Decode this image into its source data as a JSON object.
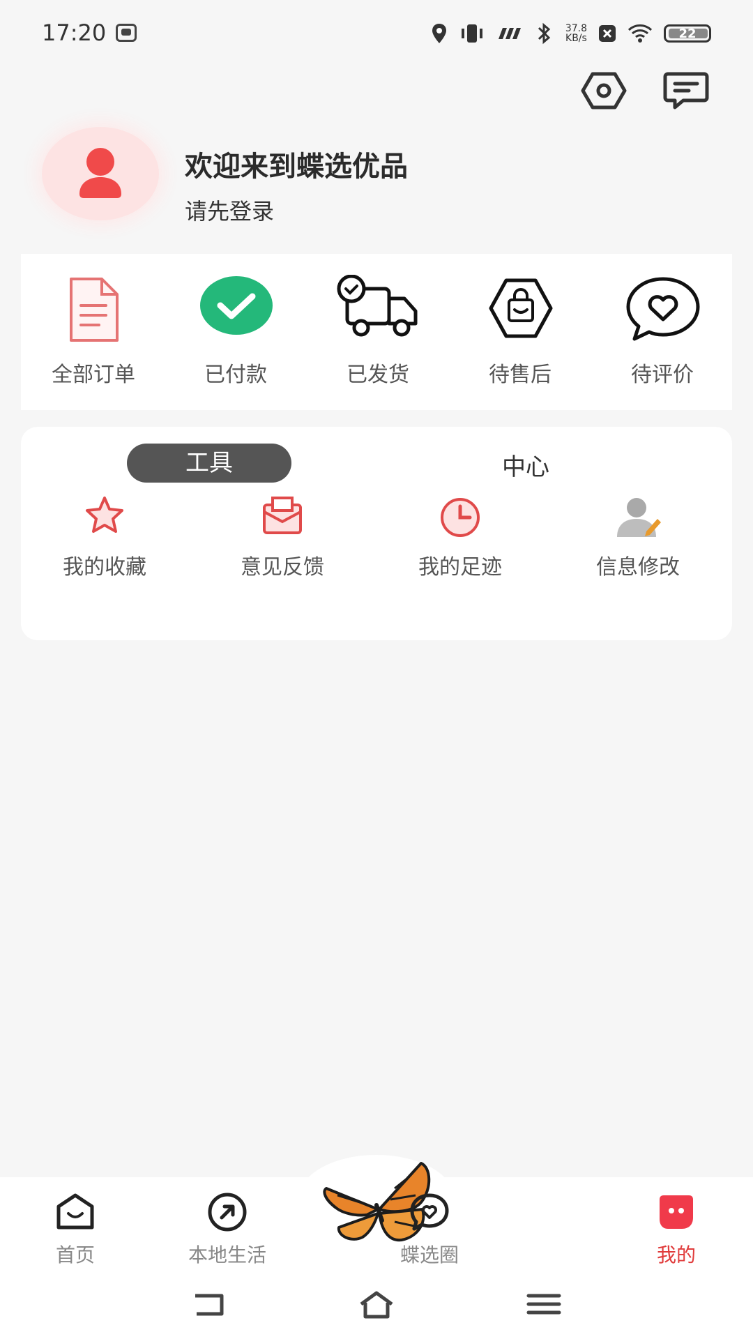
{
  "status_bar": {
    "time": "17:20",
    "speed_value": "37.8",
    "speed_unit": "KB/s",
    "battery": "22"
  },
  "header": {
    "settings_icon": "hexagon-settings-icon",
    "message_icon": "message-icon"
  },
  "profile": {
    "welcome": "欢迎来到蝶选优品",
    "login_prompt": "请先登录"
  },
  "orders": {
    "items": [
      {
        "label": "全部订单",
        "icon": "document-icon"
      },
      {
        "label": "已付款",
        "icon": "check-circle-icon"
      },
      {
        "label": "已发货",
        "icon": "truck-icon"
      },
      {
        "label": "待售后",
        "icon": "shopping-bag-icon"
      },
      {
        "label": "待评价",
        "icon": "heart-bubble-icon"
      }
    ]
  },
  "tools": {
    "tab_tools": "工具",
    "tab_center": "中心",
    "items": [
      {
        "label": "我的收藏",
        "icon": "star-icon"
      },
      {
        "label": "意见反馈",
        "icon": "mail-icon"
      },
      {
        "label": "我的足迹",
        "icon": "clock-icon"
      },
      {
        "label": "信息修改",
        "icon": "user-edit-icon"
      }
    ]
  },
  "bottom_nav": {
    "items": [
      {
        "label": "首页",
        "icon": "home-smile-icon",
        "active": false
      },
      {
        "label": "本地生活",
        "icon": "compass-icon",
        "active": false
      },
      {
        "label": "",
        "icon": "butterfly-icon",
        "active": false
      },
      {
        "label": "蝶选圈",
        "icon": "heart-chat-icon",
        "active": false
      },
      {
        "label": "我的",
        "icon": "face-icon",
        "active": true
      }
    ]
  },
  "colors": {
    "accent": "#e03a3a",
    "paid_green": "#24b87a",
    "background": "#f6f6f6"
  }
}
